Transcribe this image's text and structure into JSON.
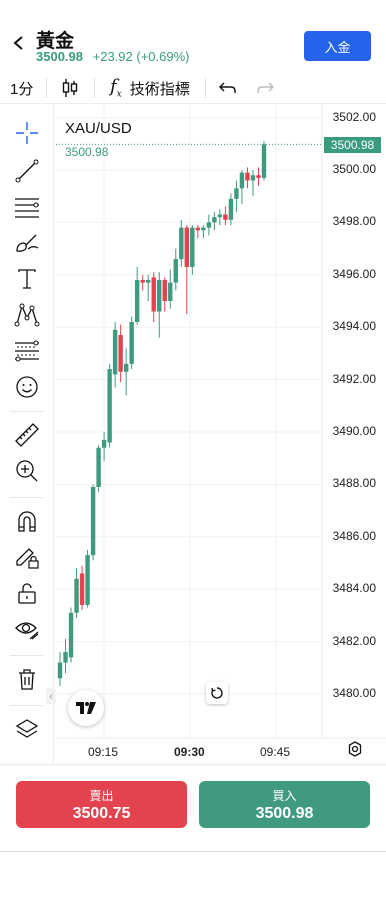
{
  "header": {
    "title": "黃金",
    "price": "3500.98",
    "change": "+23.92 (+0.69%)",
    "deposit_label": "入金"
  },
  "toolbar": {
    "interval": "1分",
    "indicators_label": "技術指標"
  },
  "chart_data": {
    "type": "candlestick",
    "symbol": "XAU/USD",
    "last_price_label": "3500.98",
    "ylim": [
      3479.5,
      3502.5
    ],
    "y_ticks": [
      "3502.00",
      "3500.00",
      "3498.00",
      "3496.00",
      "3494.00",
      "3492.00",
      "3490.00",
      "3488.00",
      "3486.00",
      "3484.00",
      "3482.00",
      "3480.00"
    ],
    "x_ticks": [
      "09:15",
      "09:30",
      "09:45"
    ],
    "bold_x_tick": "09:30",
    "up_color": "#3f9a80",
    "down_color": "#e3434f",
    "candles": [
      {
        "o": 3480.6,
        "h": 3481.6,
        "l": 3480.3,
        "c": 3481.2
      },
      {
        "o": 3481.2,
        "h": 3482.1,
        "l": 3480.8,
        "c": 3481.6
      },
      {
        "o": 3481.4,
        "h": 3483.3,
        "l": 3481.2,
        "c": 3483.1
      },
      {
        "o": 3483.1,
        "h": 3484.8,
        "l": 3482.9,
        "c": 3484.4
      },
      {
        "o": 3484.6,
        "h": 3484.9,
        "l": 3483.2,
        "c": 3483.4
      },
      {
        "o": 3483.4,
        "h": 3485.5,
        "l": 3483.3,
        "c": 3485.3
      },
      {
        "o": 3485.3,
        "h": 3488.0,
        "l": 3485.1,
        "c": 3487.9
      },
      {
        "o": 3487.9,
        "h": 3489.5,
        "l": 3487.7,
        "c": 3489.4
      },
      {
        "o": 3489.4,
        "h": 3490.0,
        "l": 3488.9,
        "c": 3489.7
      },
      {
        "o": 3489.6,
        "h": 3492.6,
        "l": 3489.4,
        "c": 3492.4
      },
      {
        "o": 3492.2,
        "h": 3494.2,
        "l": 3491.7,
        "c": 3493.9
      },
      {
        "o": 3493.7,
        "h": 3494.1,
        "l": 3491.9,
        "c": 3492.3
      },
      {
        "o": 3492.3,
        "h": 3493.2,
        "l": 3491.4,
        "c": 3492.6
      },
      {
        "o": 3492.6,
        "h": 3494.4,
        "l": 3492.4,
        "c": 3494.2
      },
      {
        "o": 3494.2,
        "h": 3496.3,
        "l": 3494.1,
        "c": 3495.8
      },
      {
        "o": 3495.8,
        "h": 3496.0,
        "l": 3495.4,
        "c": 3495.7
      },
      {
        "o": 3495.7,
        "h": 3496.0,
        "l": 3495.0,
        "c": 3495.8
      },
      {
        "o": 3495.9,
        "h": 3496.1,
        "l": 3494.2,
        "c": 3494.6
      },
      {
        "o": 3494.6,
        "h": 3496.1,
        "l": 3493.6,
        "c": 3495.8
      },
      {
        "o": 3495.8,
        "h": 3495.9,
        "l": 3494.6,
        "c": 3495.0
      },
      {
        "o": 3495.0,
        "h": 3496.2,
        "l": 3494.7,
        "c": 3495.7
      },
      {
        "o": 3495.7,
        "h": 3497.0,
        "l": 3495.4,
        "c": 3496.6
      },
      {
        "o": 3496.6,
        "h": 3498.1,
        "l": 3496.3,
        "c": 3497.8
      },
      {
        "o": 3497.8,
        "h": 3497.9,
        "l": 3494.5,
        "c": 3496.3
      },
      {
        "o": 3496.3,
        "h": 3497.9,
        "l": 3496.0,
        "c": 3497.8
      },
      {
        "o": 3497.8,
        "h": 3497.9,
        "l": 3497.4,
        "c": 3497.7
      },
      {
        "o": 3497.7,
        "h": 3497.9,
        "l": 3497.4,
        "c": 3497.8
      },
      {
        "o": 3497.8,
        "h": 3498.3,
        "l": 3497.5,
        "c": 3498.0
      },
      {
        "o": 3498.0,
        "h": 3498.4,
        "l": 3497.7,
        "c": 3498.2
      },
      {
        "o": 3498.2,
        "h": 3498.5,
        "l": 3497.9,
        "c": 3498.3
      },
      {
        "o": 3498.3,
        "h": 3498.6,
        "l": 3497.9,
        "c": 3498.1
      },
      {
        "o": 3498.1,
        "h": 3499.1,
        "l": 3497.9,
        "c": 3498.9
      },
      {
        "o": 3498.9,
        "h": 3499.6,
        "l": 3498.4,
        "c": 3499.3
      },
      {
        "o": 3499.3,
        "h": 3500.0,
        "l": 3498.7,
        "c": 3499.9
      },
      {
        "o": 3499.9,
        "h": 3500.1,
        "l": 3499.3,
        "c": 3499.6
      },
      {
        "o": 3499.6,
        "h": 3500.0,
        "l": 3499.0,
        "c": 3499.8
      },
      {
        "o": 3499.8,
        "h": 3500.1,
        "l": 3499.4,
        "c": 3499.7
      },
      {
        "o": 3499.7,
        "h": 3501.1,
        "l": 3499.6,
        "c": 3500.98
      }
    ]
  },
  "trade": {
    "sell_label": "賣出",
    "sell_price": "3500.75",
    "buy_label": "買入",
    "buy_price": "3500.98"
  }
}
